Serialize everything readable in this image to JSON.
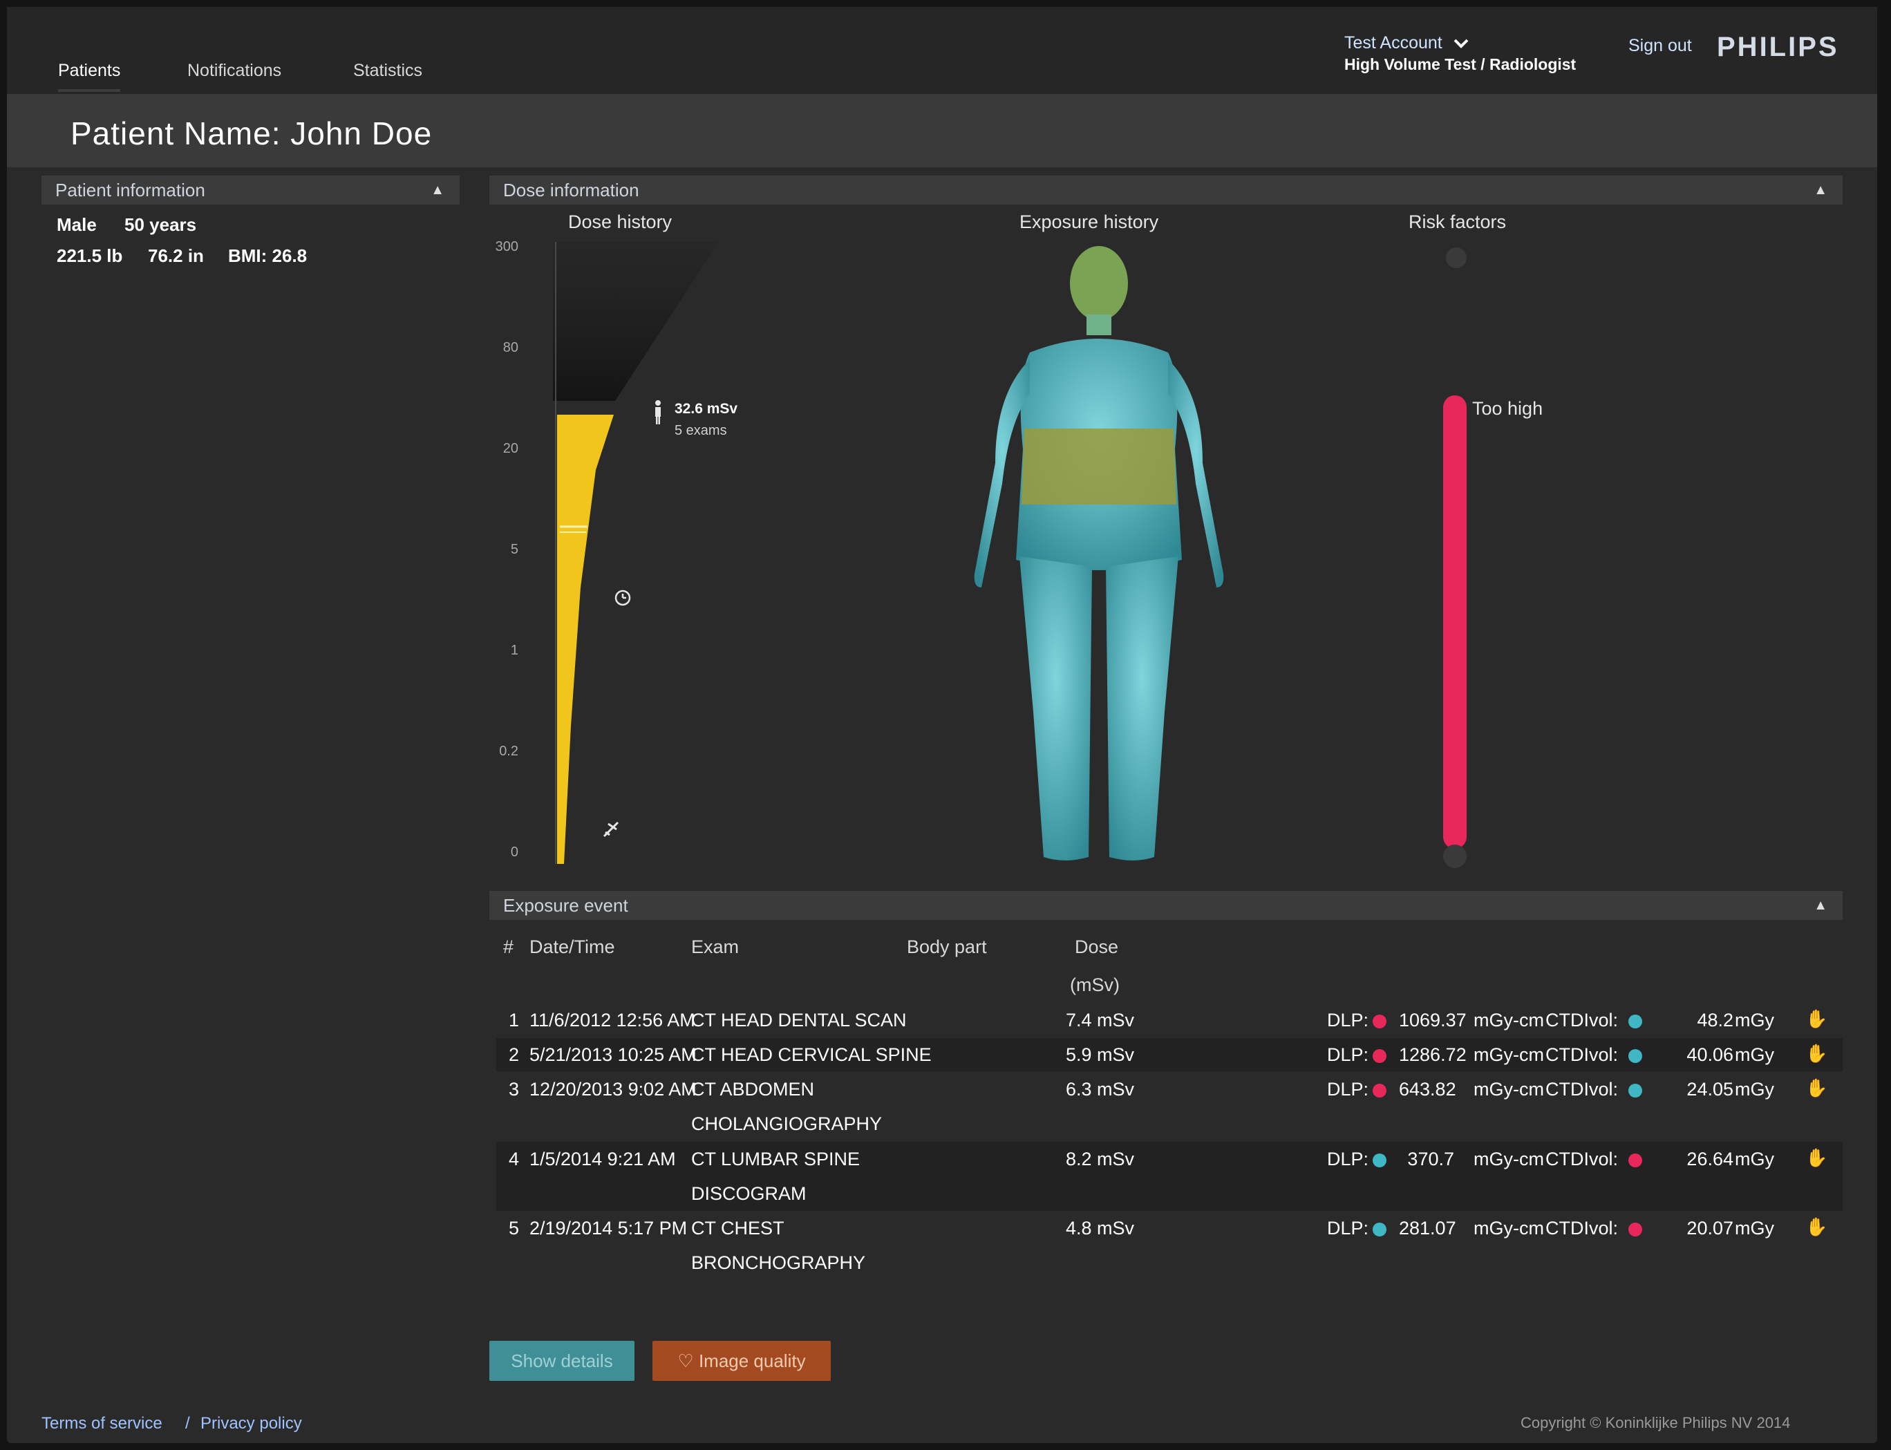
{
  "nav": {
    "tabs": [
      {
        "label": "Patients",
        "active": true
      },
      {
        "label": "Notifications"
      },
      {
        "label": "Statistics"
      }
    ],
    "account_name": "Test Account",
    "account_role": "High Volume Test / Radiologist",
    "sign_out": "Sign out",
    "brand": "PHILIPS"
  },
  "title": "Patient Name: John Doe",
  "patient_info": {
    "header": "Patient information",
    "sex": "Male",
    "age": "50 years",
    "weight": "221.5 lb",
    "height": "76.2 in",
    "bmi": "BMI: 26.8"
  },
  "dose_info": {
    "header": "Dose information",
    "dose_history_label": "Dose history",
    "exposure_history_label": "Exposure history",
    "risk_factors_label": "Risk factors",
    "cumulative_dose": "32.6 mSv",
    "exam_count": "5 exams",
    "risk_level": "Too high",
    "colors": {
      "dose_fill": "#f2c51c",
      "risk_bar": "#e8275a",
      "body": "#4fb3bd",
      "exposed_region": "#9a9a3a"
    }
  },
  "chart_data": {
    "type": "area",
    "title": "Dose history",
    "y_scale": "non-linear",
    "y_ticks": [
      "300",
      "80",
      "20",
      "5",
      "1",
      "0.2",
      "0"
    ],
    "cumulative_value": 32.6,
    "cumulative_label": "32.6 mSv",
    "markers": [
      "clock-icon",
      "plane-icon",
      "moon-icon"
    ]
  },
  "exposure_table": {
    "header": "Exposure event",
    "columns": [
      "#",
      "Date/Time",
      "Exam",
      "Body part",
      "Dose",
      "(mSv)"
    ],
    "rows": [
      {
        "n": "1",
        "datetime": "11/6/2012 12:56 AM",
        "exam": "CT HEAD DENTAL SCAN",
        "exam2": "",
        "dose": "7.4 mSv",
        "dlp_label": "DLP:",
        "dlp_status": "#e8275a",
        "dlp": "1069.37",
        "dlp_unit": "mGy-cm",
        "ctdi_label": "CTDIvol:",
        "ctdi_status": "#3fb7c4",
        "ctdi": "48.2",
        "ctdi_unit": "mGy"
      },
      {
        "n": "2",
        "datetime": "5/21/2013 10:25 AM",
        "exam": "CT HEAD CERVICAL SPINE",
        "exam2": "",
        "dose": "5.9 mSv",
        "dlp_label": "DLP:",
        "dlp_status": "#e8275a",
        "dlp": "1286.72",
        "dlp_unit": "mGy-cm",
        "ctdi_label": "CTDIvol:",
        "ctdi_status": "#3fb7c4",
        "ctdi": "40.06",
        "ctdi_unit": "mGy"
      },
      {
        "n": "3",
        "datetime": "12/20/2013 9:02 AM",
        "exam": "CT ABDOMEN",
        "exam2": "CHOLANGIOGRAPHY",
        "dose": "6.3 mSv",
        "dlp_label": "DLP:",
        "dlp_status": "#e8275a",
        "dlp": "643.82",
        "dlp_unit": "mGy-cm",
        "ctdi_label": "CTDIvol:",
        "ctdi_status": "#3fb7c4",
        "ctdi": "24.05",
        "ctdi_unit": "mGy"
      },
      {
        "n": "4",
        "datetime": "1/5/2014 9:21 AM",
        "exam": "CT LUMBAR SPINE",
        "exam2": "DISCOGRAM",
        "dose": "8.2 mSv",
        "dlp_label": "DLP:",
        "dlp_status": "#3fb7c4",
        "dlp": "370.7",
        "dlp_unit": "mGy-cm",
        "ctdi_label": "CTDIvol:",
        "ctdi_status": "#e8275a",
        "ctdi": "26.64",
        "ctdi_unit": "mGy"
      },
      {
        "n": "5",
        "datetime": "2/19/2014 5:17 PM",
        "exam": "CT CHEST",
        "exam2": "BRONCHOGRAPHY",
        "dose": "4.8 mSv",
        "dlp_label": "DLP:",
        "dlp_status": "#3fb7c4",
        "dlp": "281.07",
        "dlp_unit": "mGy-cm",
        "ctdi_label": "CTDIvol:",
        "ctdi_status": "#e8275a",
        "ctdi": "20.07",
        "ctdi_unit": "mGy"
      }
    ]
  },
  "buttons": {
    "show_details": "Show details",
    "image_quality": "Image quality",
    "show_details_color": "#3f8f97",
    "image_quality_color": "#a34a20"
  },
  "footer": {
    "terms": "Terms of service",
    "separator": "/",
    "privacy": "Privacy policy",
    "copyright": "Copyright © Koninklijke Philips NV 2014"
  }
}
